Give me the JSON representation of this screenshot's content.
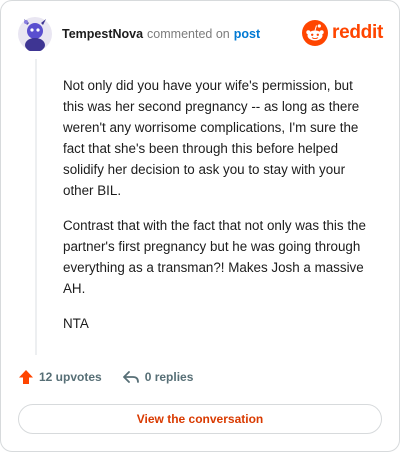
{
  "header": {
    "author": "TempestNova",
    "action": "commented on",
    "post_link": "post"
  },
  "brand": {
    "name": "reddit",
    "icon": "reddit-snoo-icon",
    "color": "#ff4500"
  },
  "comment": {
    "paragraphs": [
      "Not only did you have your wife's permission, but this was her second pregnancy -- as long as there weren't any worrisome complications, I'm sure the fact that she's been through this before helped solidify her decision to ask you to stay with your other BIL.",
      "Contrast that with the fact that not only was this the partner's first pregnancy but he was going through everything as a transman?! Makes Josh a massive AH.",
      "NTA"
    ]
  },
  "footer": {
    "upvotes": "12 upvotes",
    "upvote_icon": "upvote-arrow-icon",
    "replies": "0 replies",
    "reply_icon": "reply-arrow-icon",
    "upvote_color": "#ff4500"
  },
  "cta": {
    "label": "View the conversation",
    "color": "#d93a00"
  }
}
